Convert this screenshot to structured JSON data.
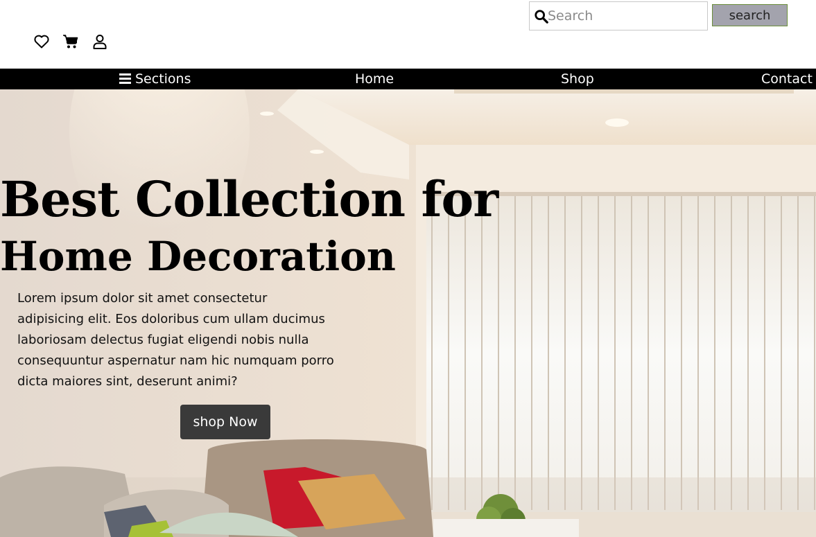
{
  "header": {
    "search": {
      "placeholder": "Search",
      "value": "",
      "button_label": "search"
    },
    "icons": [
      "heart-icon",
      "cart-icon",
      "user-icon"
    ]
  },
  "nav": {
    "sections_label": "Sections",
    "home_label": "Home",
    "shop_label": "Shop",
    "contact_label": "Contact"
  },
  "hero": {
    "title_line1": "Best Collection for",
    "title_line2": "Home Decoration",
    "description": "Lorem ipsum dolor sit amet consectetur adipisicing elit. Eos doloribus cum ullam ducimus laboriosam delectus fugiat eligendi nobis nulla consequuntur aspernatur nam hic numquam porro dicta maiores sint, deserunt animi?",
    "cta_label": "shop Now"
  },
  "colors": {
    "navbar_bg": "#000000",
    "nav_text": "#ffffff",
    "search_button_bg": "#a3a3ad",
    "search_button_border": "#6b8e3a",
    "cta_bg": "#3a3a3a"
  }
}
